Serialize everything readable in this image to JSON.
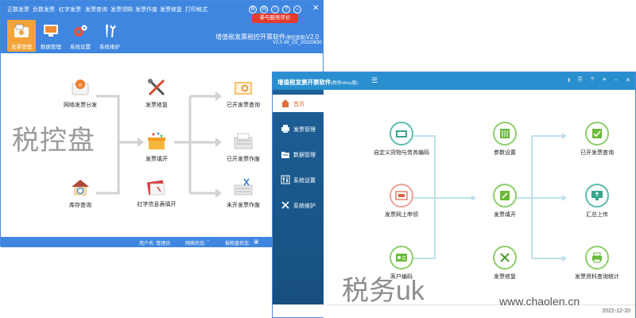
{
  "w1": {
    "menu": [
      "正数发票",
      "负数发票",
      "红字发票",
      "发票查询",
      "发票领购",
      "发票作废",
      "发票修复",
      "打印格式"
    ],
    "toolbar": [
      "发票管理",
      "数据管理",
      "系统设置",
      "系统维护"
    ],
    "eval_button": "参与服务评价",
    "title": "增值税发票税控开票软件",
    "title_sub": "(税控盘版)",
    "title_ver": "V2.0",
    "version": "V2.0.49_ZS_20220630",
    "nodes": {
      "distribute": "网络发票分发",
      "inventory": "库存查询",
      "repair": "发票修复",
      "fill": "发票填开",
      "red_form": "红字信息表填开",
      "query": "已开发票查询",
      "void": "已开发票作废",
      "unissued_void": "未开发票作废"
    },
    "status": {
      "user": "用户名: 管理员",
      "network": "网络状态:",
      "report": "报税盘状态:"
    },
    "watermark": "税控盘"
  },
  "w2": {
    "title": "增值税发票开票软件",
    "title_sub": "(税务UKey版)",
    "menu_icon": "☰",
    "ctrls": [
      "⇟",
      "⎘",
      "?",
      "≡",
      "–",
      "✕"
    ],
    "sidebar": [
      "首页",
      "发票管理",
      "数据管理",
      "系统设置",
      "系统维护"
    ],
    "nodes": {
      "goods": "自定义货物与劳务编码",
      "apply": "发票网上申领",
      "customer": "客户编码",
      "params": "参数设置",
      "fill": "发票填开",
      "repair": "发票修复",
      "query": "已开发票查询",
      "upload": "汇总上传",
      "stats": "发票资料查询统计"
    },
    "date": "2022-12-20",
    "watermark": "税务uk"
  },
  "site_watermark": "www.chaolen.cn",
  "colors": {
    "toolbar_blue": "#3f86e0",
    "active_orange": "#f2a43a",
    "eval_red": "#e33b2e",
    "sidebar_navy": "#1d5f97",
    "titlebar_blue": "#2a8fcf"
  }
}
